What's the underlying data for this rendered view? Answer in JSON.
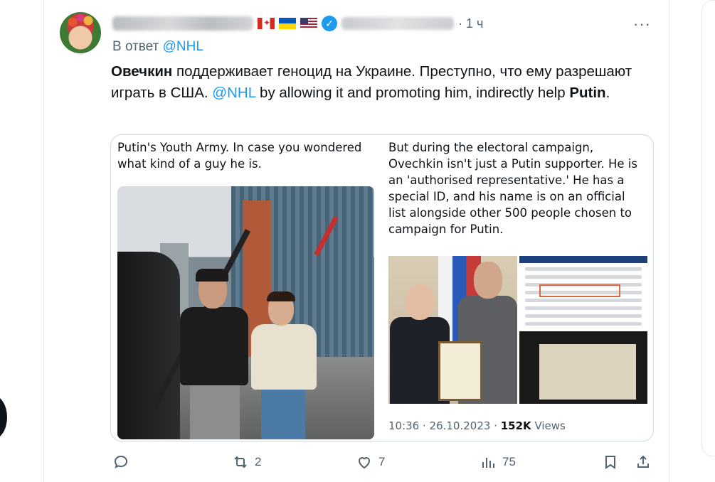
{
  "tweet": {
    "time": "· 1 ч",
    "reply_prefix": "В ответ",
    "reply_mention": "@NHL",
    "more": "···",
    "text": {
      "part1_bold": "Овечкин",
      "part1": " поддерживает геноцид на Украине. Преступно, что ему разрешают играть в США. ",
      "mention": "@NHL",
      "part2": " by allowing it and promoting him, indirectly help ",
      "part2_bold": "Putin",
      "part3": "."
    }
  },
  "media": {
    "caption_left": "Putin's Youth Army. In case you wondered what kind of a guy he is.",
    "caption_right": "But during the electoral campaign, Ovechkin isn't just a Putin supporter. He is an 'authorised representative.' He has a special ID, and his name is on an official list alongside other 500 people chosen to campaign for Putin.",
    "stats_time": "10:36 · 26.10.2023 · ",
    "stats_views": "152K",
    "stats_views_label": " Views"
  },
  "actions": {
    "reply_count": "",
    "retweet_count": "2",
    "like_count": "7",
    "views_count": "75"
  },
  "icons": [
    "reply-icon",
    "retweet-icon",
    "like-icon",
    "views-icon",
    "bookmark-icon",
    "share-icon",
    "verified-icon",
    "more-icon"
  ],
  "colors": {
    "accent": "#1d9bf0",
    "muted": "#536471",
    "text": "#0f1419"
  }
}
